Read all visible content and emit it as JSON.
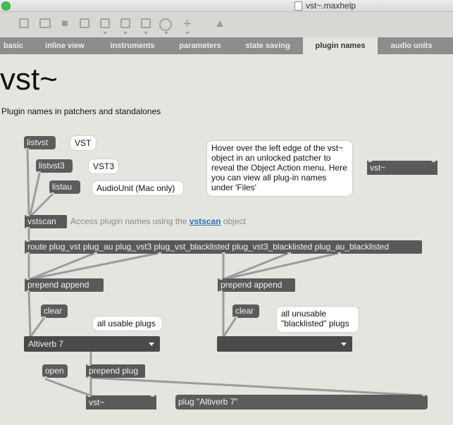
{
  "window": {
    "title": "vst~.maxhelp"
  },
  "toolbar": {
    "icons": [
      "new-view-icon",
      "presentation-icon",
      "comment-icon",
      "clear-icon",
      "object-box-icon",
      "message-box-icon",
      "number-box-icon",
      "dial-icon",
      "add-icon",
      "paint-bucket-icon"
    ]
  },
  "tabs": [
    {
      "label": "basic"
    },
    {
      "label": "inline view"
    },
    {
      "label": "instruments"
    },
    {
      "label": "parameters"
    },
    {
      "label": "state saving"
    },
    {
      "label": "plugin names"
    },
    {
      "label": "audio units"
    }
  ],
  "heading": "vst~",
  "subheading": "Plugin names in patchers and standalones",
  "messages": {
    "listvst": "listvst",
    "listvst3": "listvst3",
    "listau": "listau",
    "clear_left": "clear",
    "clear_right": "clear",
    "open": "open"
  },
  "objects": {
    "vstscan": "vstscan",
    "route": "route plug_vst plug_au plug_vst3 plug_vst_blacklisted plug_vst3_blacklisted plug_au_blacklisted",
    "prepend_left": "prepend append",
    "prepend_right": "prepend append",
    "prepend_plug": "prepend plug",
    "vst_bottom": "vst~",
    "vst_top": "vst~",
    "plug_message": "plug \"Altiverb 7\""
  },
  "bubbles": {
    "vst": "VST",
    "vst3": "VST3",
    "audiounit": "AudioUnit (Mac only)",
    "hover": "Hover over the left edge of the vst~ object in an unlocked patcher to reveal the Object Action menu. Here you can view all plug-in names under 'Files'",
    "usable": "all usable plugs",
    "unusable": "all unusable \"blacklisted\" plugs"
  },
  "access_comment": {
    "before": "Access plugin names using the ",
    "link": "vstscan",
    "after": " object"
  },
  "menus": {
    "left_selected": "Altiverb 7",
    "right_selected": ""
  }
}
